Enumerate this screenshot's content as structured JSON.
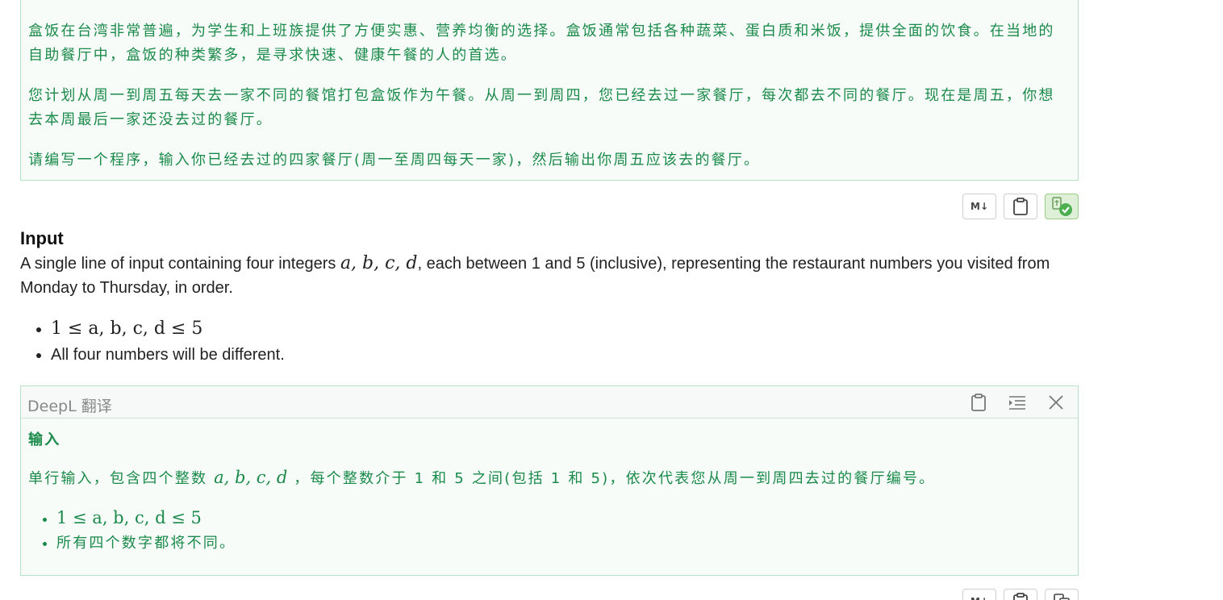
{
  "top_translation": {
    "paragraphs": [
      "盒饭在台湾非常普遍，为学生和上班族提供了方便实惠、营养均衡的选择。盒饭通常包括各种蔬菜、蛋白质和米饭，提供全面的饮食。在当地的自助餐厅中，盒饭的种类繁多，是寻求快速、健康午餐的人的首选。",
      "您计划从周一到周五每天去一家不同的餐馆打包盒饭作为午餐。从周一到周四，您已经去过一家餐厅，每次都去不同的餐厅。现在是周五，你想去本周最后一家还没去过的餐厅。",
      "请编写一个程序，输入你已经去过的四家餐厅(周一至周四每天一家)，然后输出你周五应该去的餐厅。"
    ]
  },
  "toolbar": {
    "md_label": "M↓"
  },
  "input_section": {
    "title": "Input",
    "description_pre": "A single line of input containing four integers ",
    "description_math": "a, b, c, d",
    "description_post": ", each between 1 and 5 (inclusive), representing the restaurant numbers you visited from Monday to Thursday, in order.",
    "constraints": [
      {
        "math": "1 ≤ a, b, c, d ≤ 5"
      },
      {
        "text": "All four numbers will be different."
      }
    ]
  },
  "deepl_panel": {
    "title": "DeepL 翻译",
    "heading": "输入",
    "text_pre": "单行输入，包含四个整数 ",
    "text_math": "a, b, c, d",
    "text_post": " ，每个整数介于 1 和 5 之间(包括 1 和 5)，依次代表您从周一到周四去过的餐厅编号。",
    "items": [
      {
        "math": "1 ≤ a, b, c, d ≤ 5"
      },
      {
        "text": "所有四个数字都将不同。"
      }
    ]
  },
  "colors": {
    "accent_green": "#1a8a4a",
    "panel_border": "#b8e0c8",
    "check_green": "#4caf50"
  }
}
